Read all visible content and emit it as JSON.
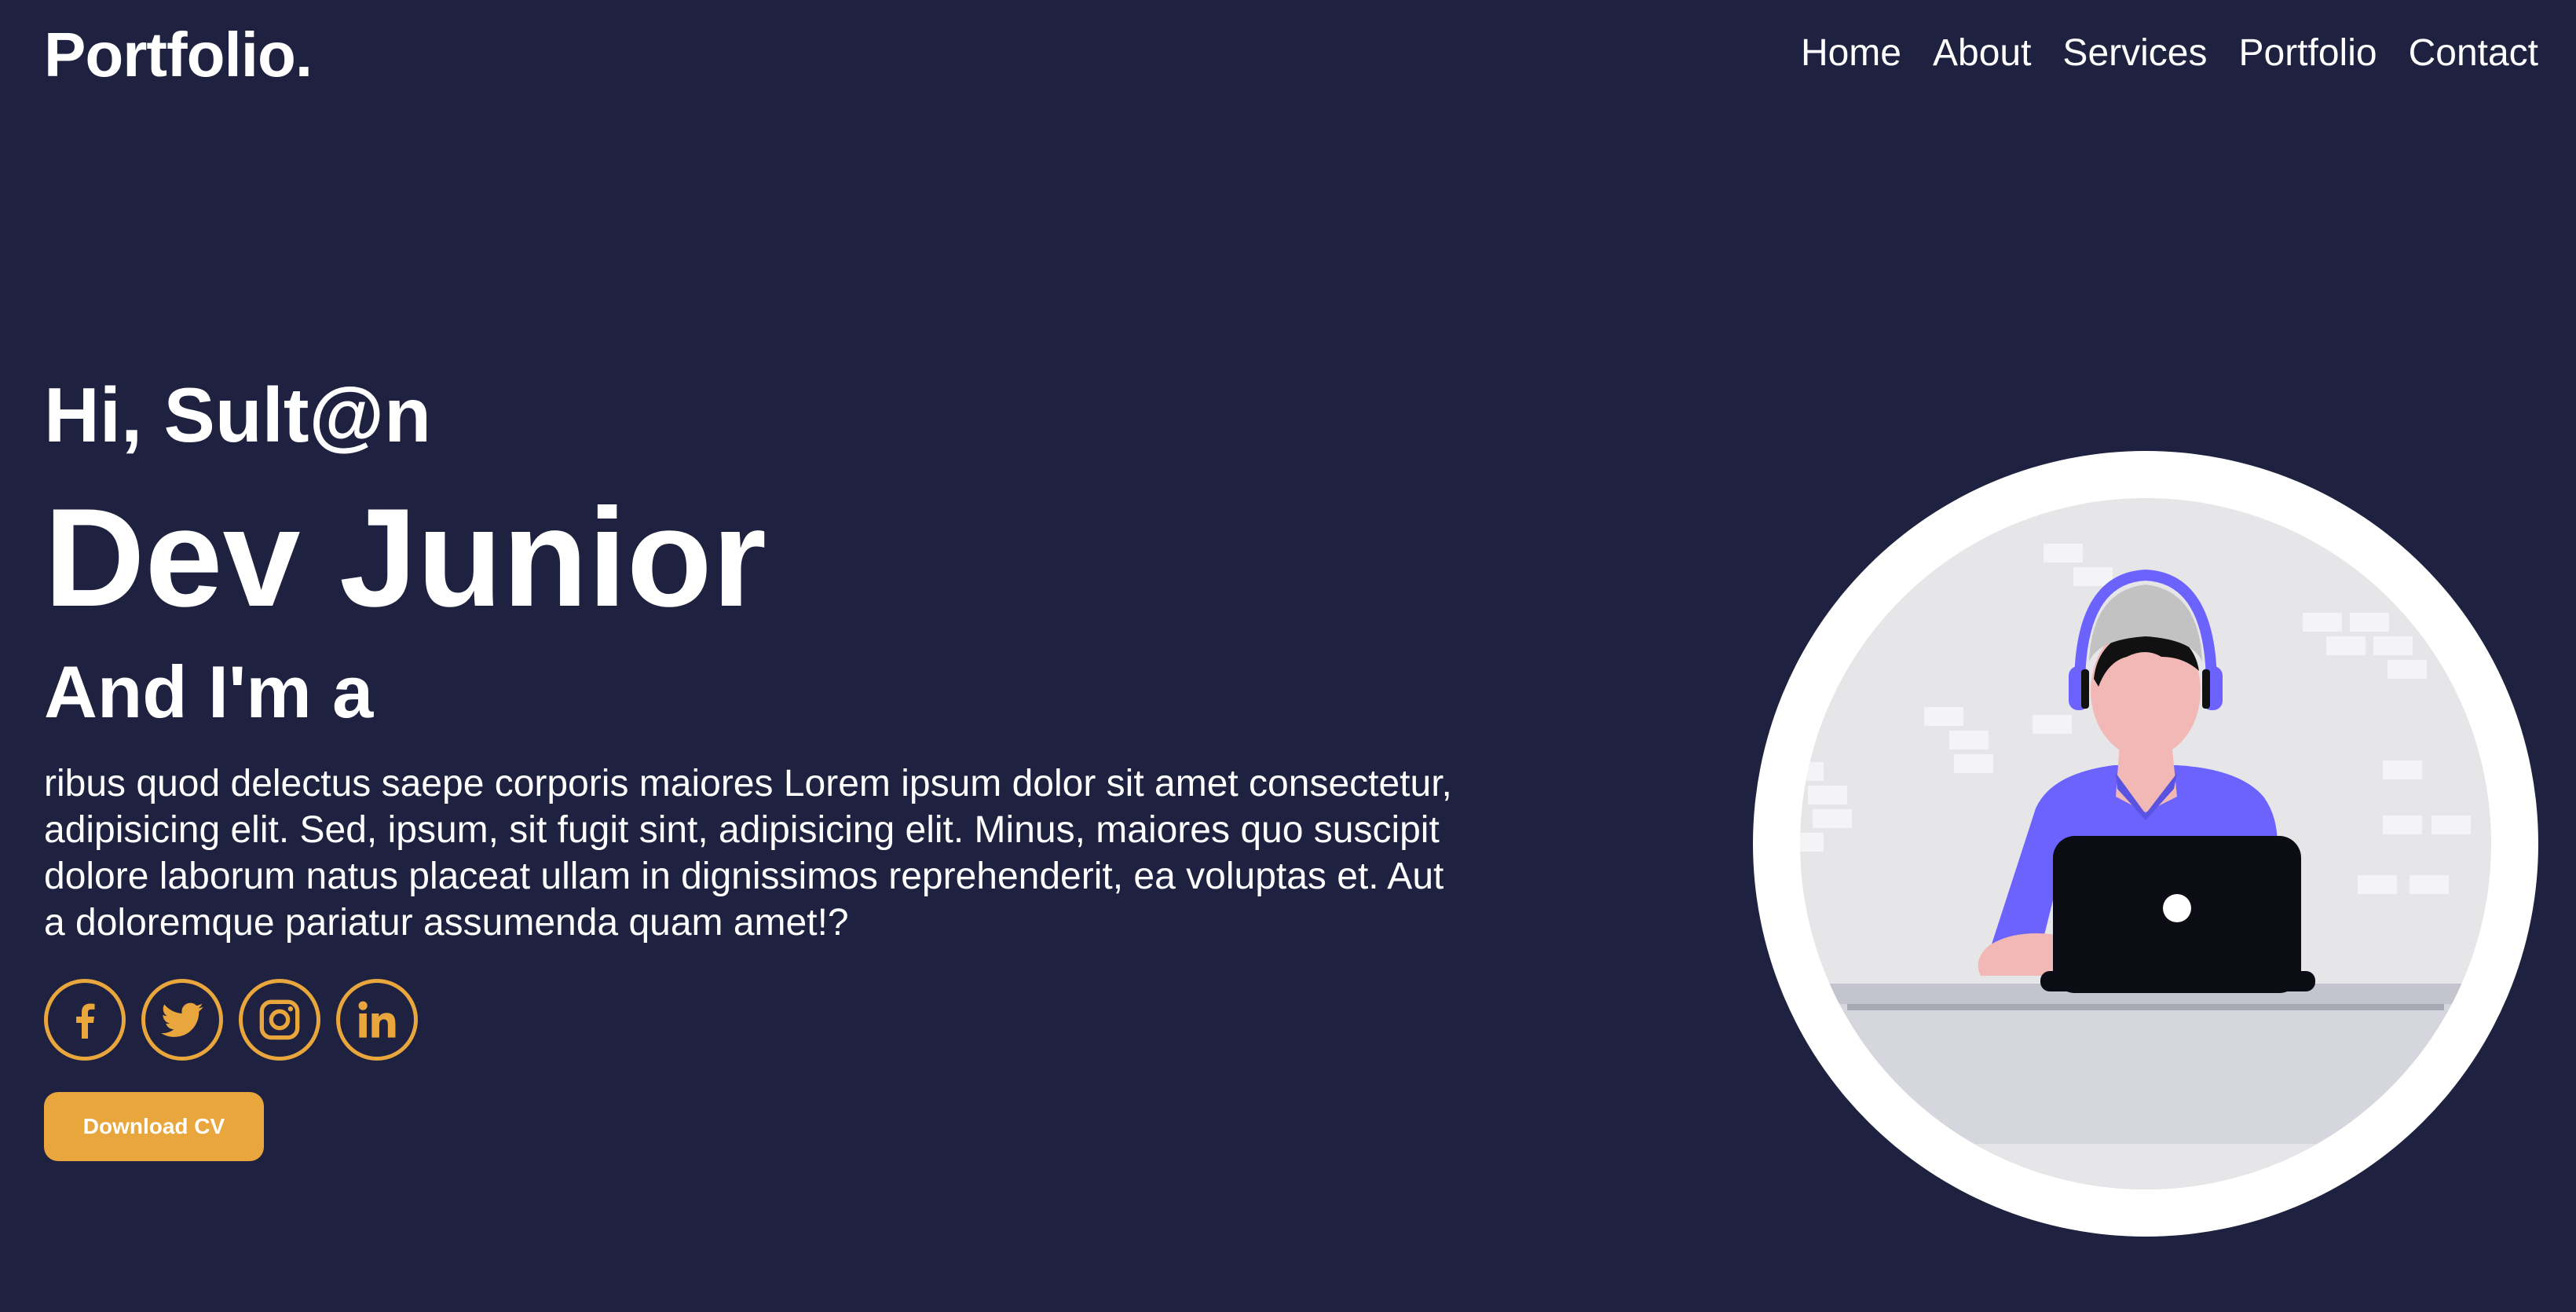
{
  "header": {
    "logo": "Portfolio.",
    "nav": [
      "Home",
      "About",
      "Services",
      "Portfolio",
      "Contact"
    ]
  },
  "hero": {
    "greeting": "Hi, Sult@n",
    "role": "Dev Junior",
    "intro": "And I'm a",
    "description": "ribus quod delectus saepe corporis maiores Lorem ipsum dolor sit amet consectetur, adipisicing elit. Sed, ipsum, sit fugit sint, adipisicing elit. Minus, maiores quo suscipit dolore laborum natus placeat ullam in dignissimos reprehenderit, ea voluptas et. Aut a doloremque pariatur assumenda quam amet!?",
    "download_label": "Download CV"
  },
  "socials": [
    {
      "icon": "facebook-icon"
    },
    {
      "icon": "twitter-icon"
    },
    {
      "icon": "instagram-icon"
    },
    {
      "icon": "linkedin-icon"
    }
  ],
  "colors": {
    "background": "#1e2240",
    "accent": "#e8a63c",
    "text": "#ffffff",
    "illustration_shirt": "#6c63ff"
  }
}
